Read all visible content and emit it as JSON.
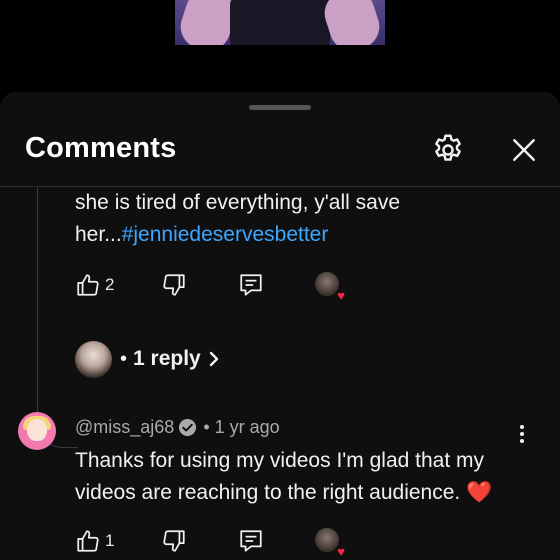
{
  "header": {
    "title": "Comments"
  },
  "previous_comment": {
    "text_plain": "she is tired of everything, y'all save her...",
    "hashtag": "#jenniedeservesbetter",
    "like_count": "2"
  },
  "replies": {
    "dot": "•",
    "label": "1 reply"
  },
  "comment": {
    "handle": "@miss_aj68",
    "separator": "•",
    "time": "1 yr ago",
    "text": "Thanks for using my videos I'm glad that my videos are reaching to the right audience. ❤️",
    "like_count": "1"
  },
  "icons": {
    "settings": "gear-icon",
    "close": "close-icon",
    "like": "thumbs-up-icon",
    "dislike": "thumbs-down-icon",
    "reply": "reply-comment-icon",
    "creator_heart": "creator-heart-icon",
    "verified": "verified-check-icon",
    "chevron": "chevron-right-icon",
    "more": "more-vertical-icon"
  },
  "colors": {
    "background": "#0f0f0f",
    "hashtag": "#3ea6ff",
    "heart": "#ff2244",
    "text": "#f1f1f1"
  }
}
